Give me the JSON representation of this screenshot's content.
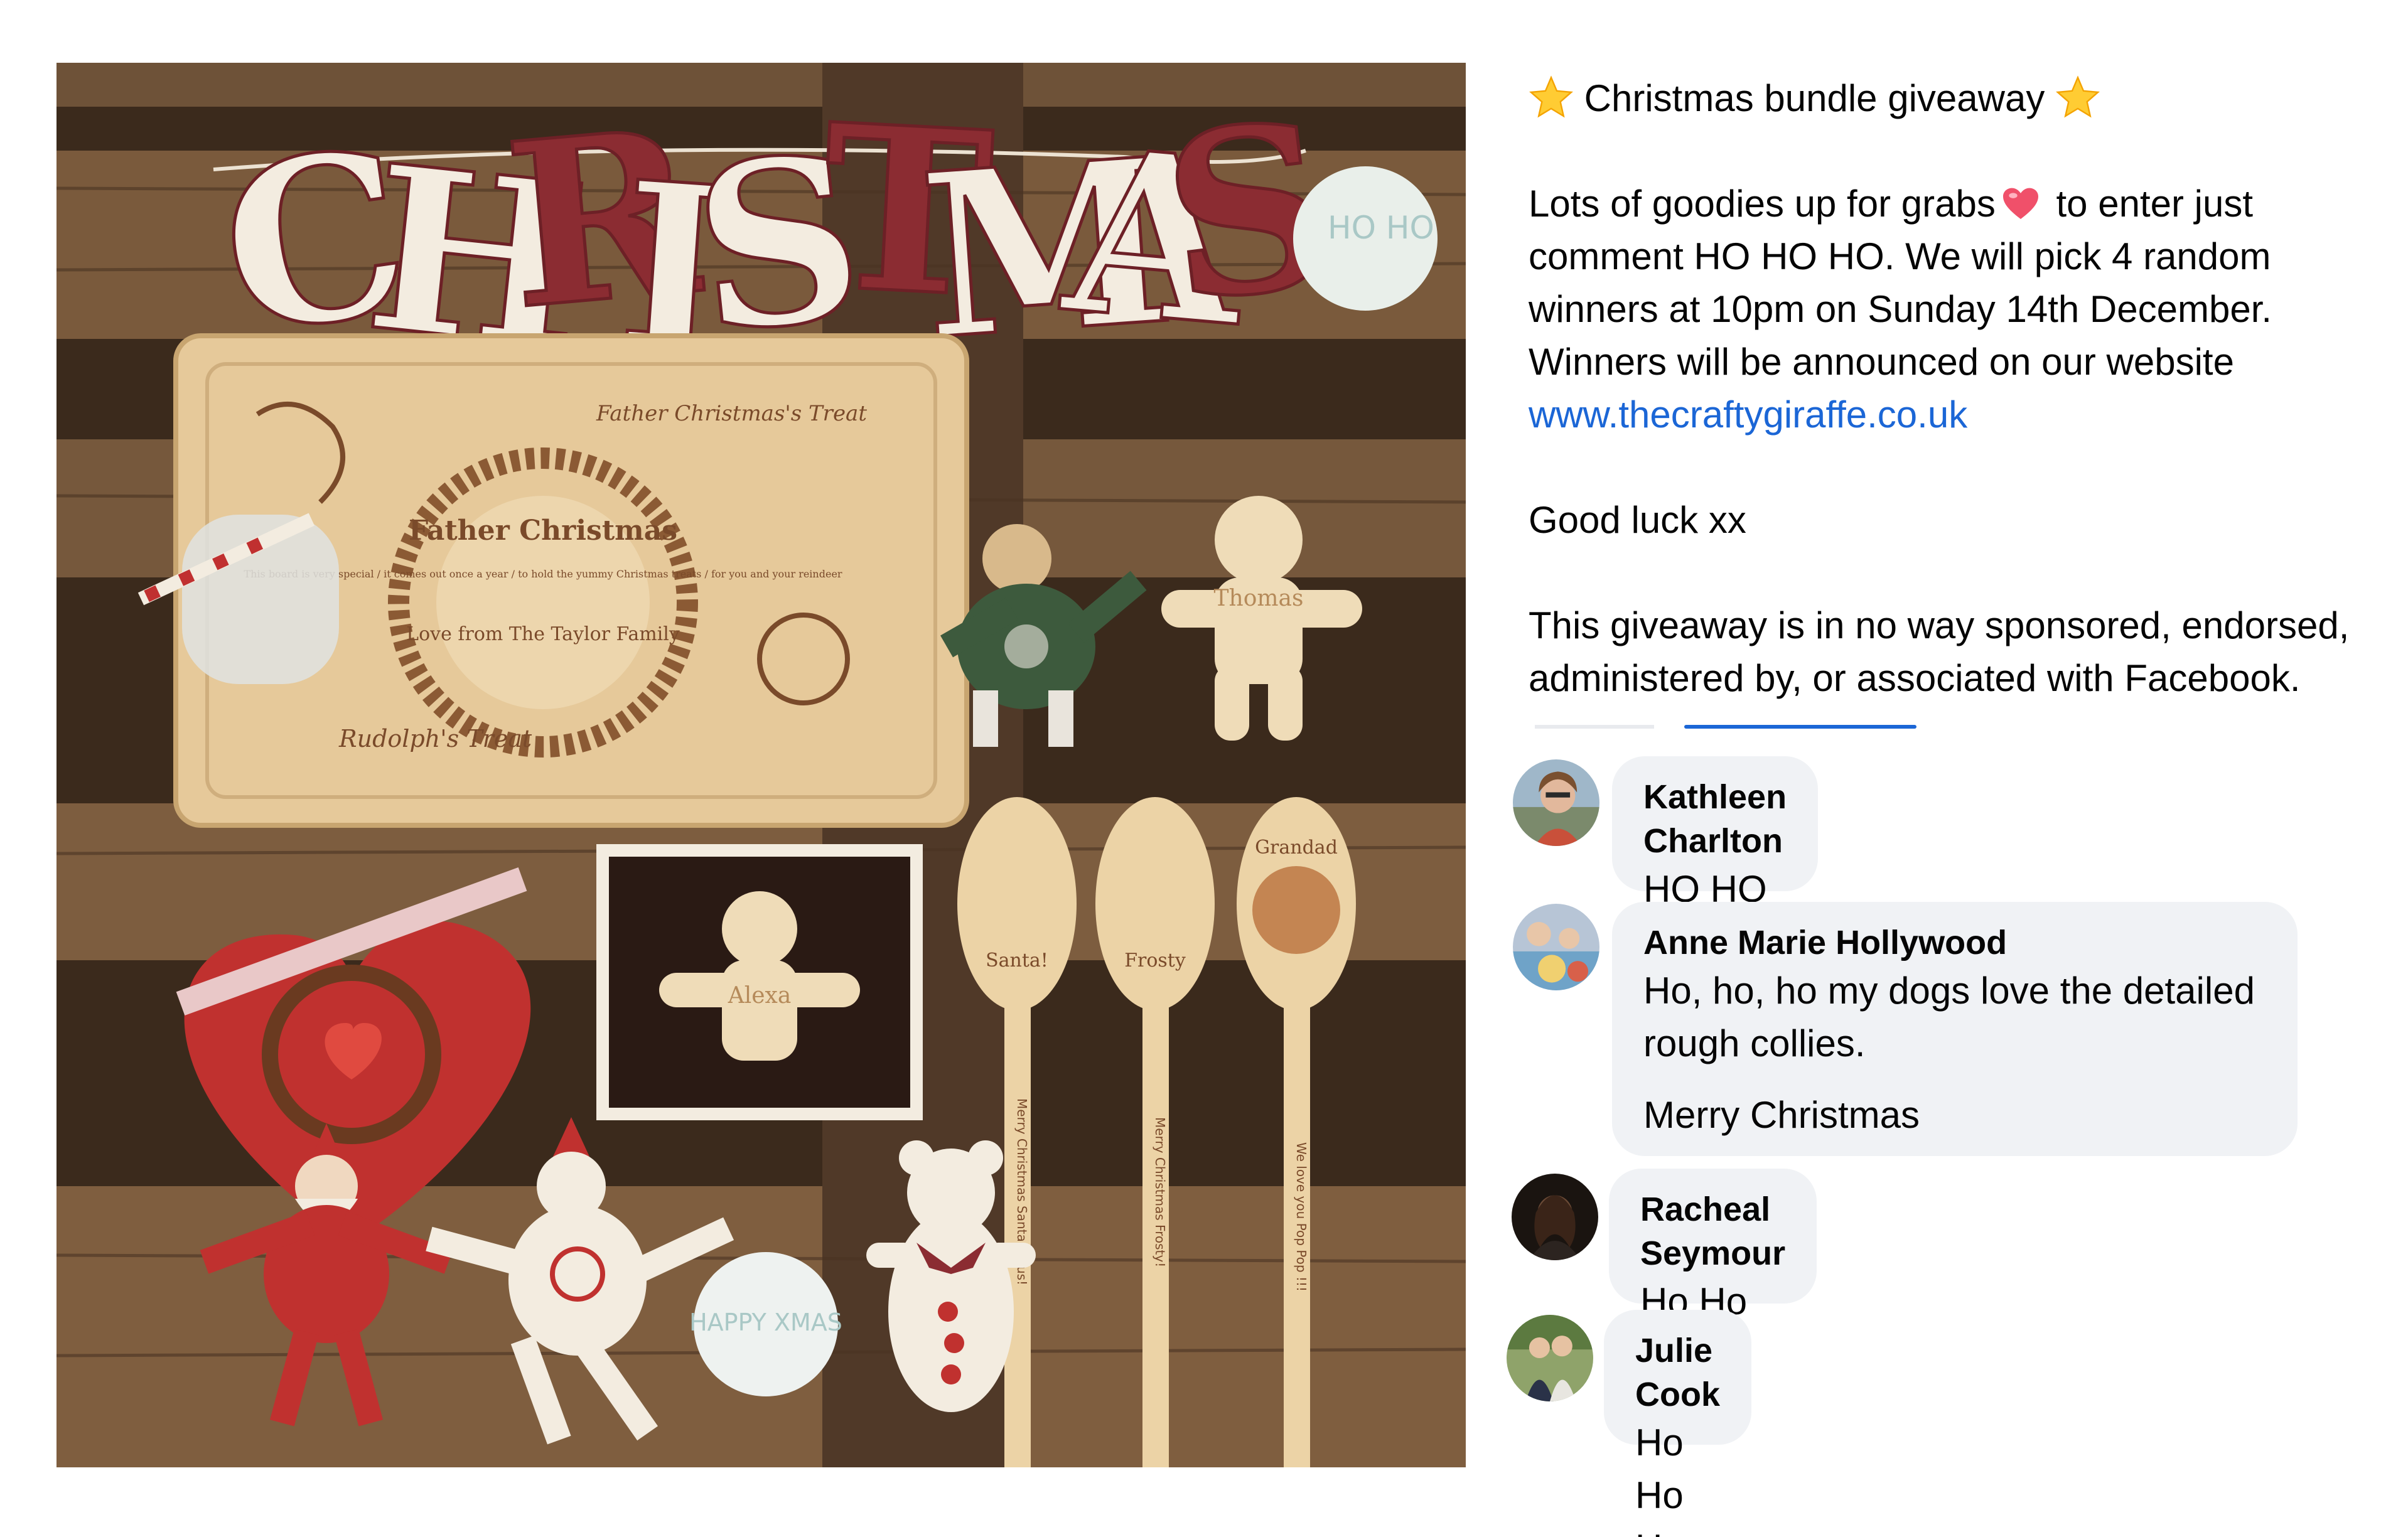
{
  "post": {
    "title": "Christmas bundle giveaway",
    "body_before_heart": "Lots of goodies up for grabs",
    "body_after_heart": " to enter just comment HO HO HO. We will pick 4 random winners at 10pm on Sunday 14th December. Winners will be announced on our website ",
    "website_link": "www.thecraftygiraffe.co.uk",
    "sign_off": "Good luck xx",
    "disclaimer": "This giveaway is in no way sponsored, endorsed, administered by, or associated with Facebook."
  },
  "photo": {
    "letters": [
      "C",
      "H",
      "R",
      "I",
      "S",
      "T",
      "M",
      "A",
      "S"
    ],
    "bauble_text": "HO HO",
    "board_header": "Father Christmas's Treat",
    "board_title": "Father Christmas",
    "board_small_text": "This board is very special / it comes out once a year / to hold the yummy Christmas treats / for you and your reindeer",
    "board_signature": "Love from The Taylor Family",
    "board_footer": "Rudolph's Treat",
    "gingerbread_1": "Thomas",
    "gingerbread_2": "Alexa",
    "spoon_1_top": "Santa!",
    "spoon_2_top": "Frosty",
    "spoon_3_top": "Grandad",
    "spoon_1_handle": "Merry Christmas Santa Claus!",
    "spoon_2_handle": "Merry Christmas Frosty!",
    "spoon_3_handle": "We love you Pop Pop !!!",
    "tag_text": "HAPPY XMAS"
  },
  "comments": [
    {
      "author": "Kathleen Charlton",
      "text": "HO HO HO"
    },
    {
      "author": "Anne Marie Hollywood",
      "text": "Ho, ho, ho my dogs love the detailed rough collies.",
      "text2": "Merry Christmas"
    },
    {
      "author": "Racheal Seymour",
      "text": "Ho Ho Ho"
    },
    {
      "author": "Julie Cook",
      "text": "Ho Ho Ho"
    }
  ],
  "colors": {
    "link": "#1b66d6",
    "bubble": "#f0f2f5",
    "christmas_red": "#8b2c32",
    "wood": "#e6c99a"
  },
  "icons": [
    "star-emoji-icon",
    "heart-emoji-icon"
  ]
}
